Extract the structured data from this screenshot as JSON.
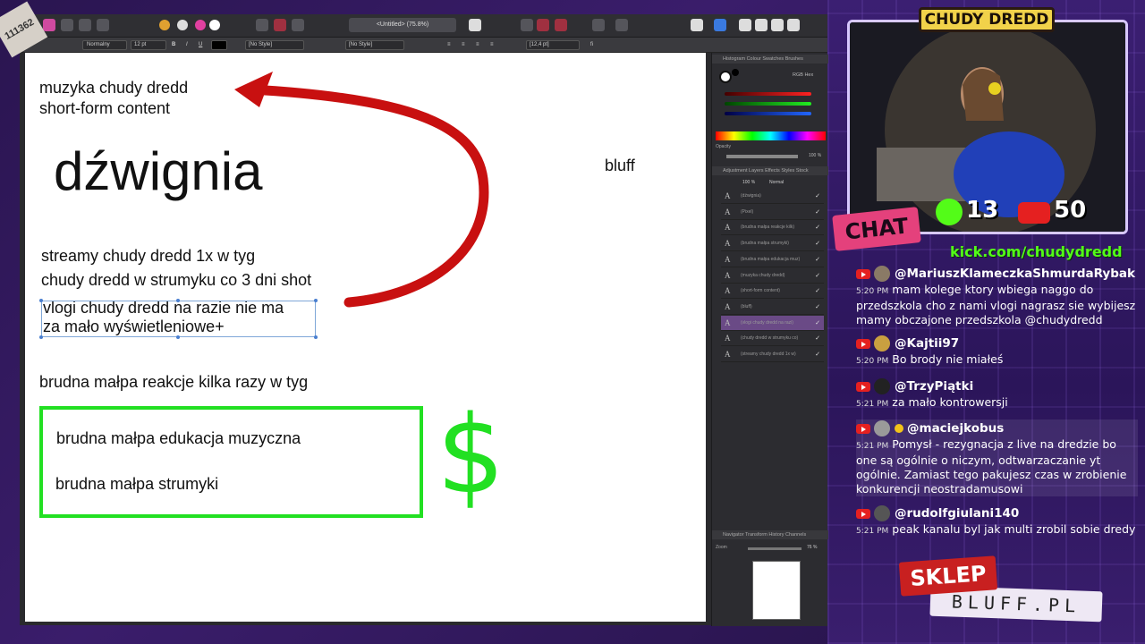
{
  "sticker": {
    "text": "111362"
  },
  "app": {
    "doc_title": "<Untitled> (75.8%)",
    "context": {
      "style": "Normalny",
      "size": "12 pt",
      "char_style": "[No Style]",
      "para_style": "[No Style]",
      "leading": "[12,4 pt]"
    }
  },
  "doc": {
    "line1": "muzyka chudy dredd",
    "line2": "short-form content",
    "heading": "dźwignia",
    "bluff": "bluff",
    "s1": "streamy chudy dredd 1x w tyg",
    "s2": "chudy dredd w strumyku co 3 dni shot",
    "s3a": "vlogi chudy dredd na razie nie ma",
    "s3b": "za mało wyświetleniowe+",
    "brudna": "brudna małpa reakcje kilka razy w tyg",
    "box1": "brudna małpa edukacja muzyczna",
    "box2": "brudna małpa strumyki",
    "dollar": "$"
  },
  "panel": {
    "tabs_top": "Histogram  Colour  Swatches  Brushes",
    "color_mode": "RGB Hex",
    "opacity_label": "Opacity",
    "opacity_value": "100 %",
    "tabs_layers": "Adjustment  Layers  Effects  Styles  Stock",
    "layer_opacity": "100 %",
    "blend": "Normal",
    "layers": [
      {
        "name": "(dźwignia)"
      },
      {
        "name": "(Pixel)"
      },
      {
        "name": "(brudna małpa reakcje kilk)"
      },
      {
        "name": "(brudna małpa strumyki)"
      },
      {
        "name": "(brudna małpa edukacja muz)"
      },
      {
        "name": "(muzyka chudy dredd)"
      },
      {
        "name": "(short-form content)"
      },
      {
        "name": "(bluff)"
      },
      {
        "name": "(vlogi chudy dredd na razi)"
      },
      {
        "name": "(chudy dredd w strumyku co)"
      },
      {
        "name": "(streamy chudy dredd 1x w)"
      }
    ],
    "tabs_nav": "Navigator  Transform  History  Channels",
    "zoom_label": "Zoom",
    "zoom_value": "76 %"
  },
  "stream": {
    "title": "CHUDY DREDD",
    "kick_viewers": "13",
    "yt_viewers": "50",
    "chat_label": "CHAT",
    "kick_url": "kick.com/chudydredd",
    "shop_tag": "SKLEP",
    "shop_url": "BLUFF.PL"
  },
  "chat": [
    {
      "user": "@MariuszKlameczkaShmurdaRybak",
      "time": "5:20 PM",
      "text": "mam kolege ktory wbiega naggo do przedszkola cho z nami vlogi nagrasz sie wybijesz mamy obczajone przedszkola @chudydredd"
    },
    {
      "user": "@Kajtii97",
      "time": "5:20 PM",
      "text": "Bo brody nie miałeś"
    },
    {
      "user": "@TrzyPiątki",
      "time": "5:21 PM",
      "text": "za mało kontrowersji"
    },
    {
      "user": "@maciejkobus",
      "time": "5:21 PM",
      "text": "Pomysł - rezygnacja z live na dredzie bo one są ogólnie o niczym, odtwarzaczanie yt ogólnie. Zamiast tego pakujesz czas w zrobienie konkurencji neostradamusowi"
    },
    {
      "user": "@rudolfgiulani140",
      "time": "5:21 PM",
      "text": "peak kanalu byl jak multi zrobil sobie dredy"
    }
  ]
}
